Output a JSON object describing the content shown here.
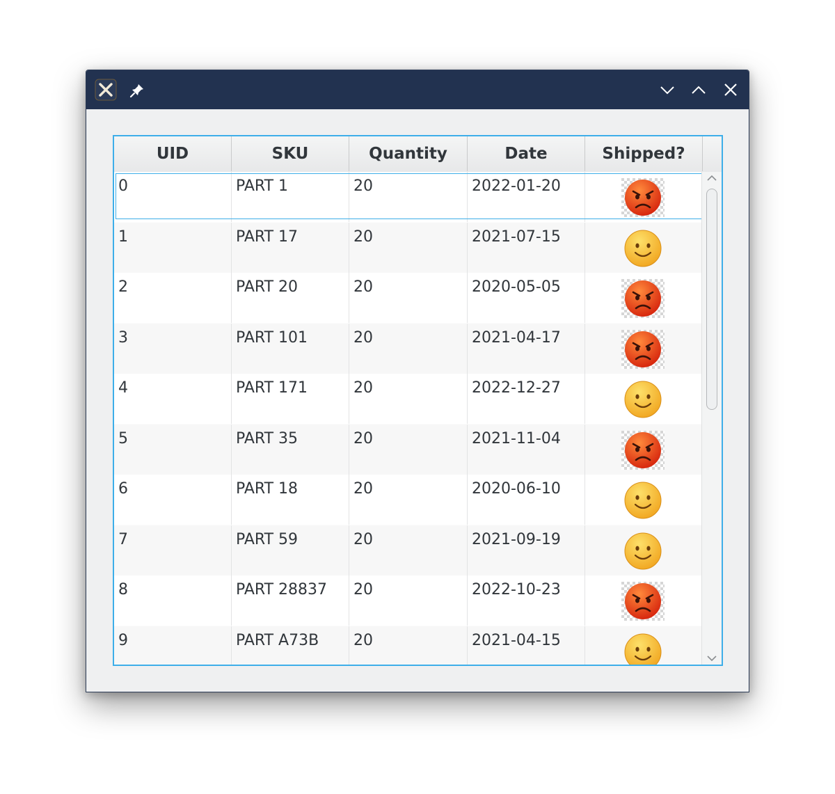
{
  "window": {
    "title": "",
    "controls": [
      "app-icon",
      "pin-icon",
      "minimize-icon",
      "maximize-icon",
      "close-icon"
    ]
  },
  "table": {
    "columns": [
      "UID",
      "SKU",
      "Quantity",
      "Date",
      "Shipped?"
    ],
    "selected_row": 0,
    "rows": [
      {
        "uid": "0",
        "sku": "PART 1",
        "quantity": "20",
        "date": "2022-01-20",
        "shipped": "angry-face-icon"
      },
      {
        "uid": "1",
        "sku": "PART 17",
        "quantity": "20",
        "date": "2021-07-15",
        "shipped": "smiley-face-icon"
      },
      {
        "uid": "2",
        "sku": "PART 20",
        "quantity": "20",
        "date": "2020-05-05",
        "shipped": "angry-face-icon"
      },
      {
        "uid": "3",
        "sku": "PART 101",
        "quantity": "20",
        "date": "2021-04-17",
        "shipped": "angry-face-icon"
      },
      {
        "uid": "4",
        "sku": "PART 171",
        "quantity": "20",
        "date": "2022-12-27",
        "shipped": "smiley-face-icon"
      },
      {
        "uid": "5",
        "sku": "PART 35",
        "quantity": "20",
        "date": "2021-11-04",
        "shipped": "angry-face-icon"
      },
      {
        "uid": "6",
        "sku": "PART 18",
        "quantity": "20",
        "date": "2020-06-10",
        "shipped": "smiley-face-icon"
      },
      {
        "uid": "7",
        "sku": "PART 59",
        "quantity": "20",
        "date": "2021-09-19",
        "shipped": "smiley-face-icon"
      },
      {
        "uid": "8",
        "sku": "PART 28837",
        "quantity": "20",
        "date": "2022-10-23",
        "shipped": "angry-face-icon"
      },
      {
        "uid": "9",
        "sku": "PART A73B",
        "quantity": "20",
        "date": "2021-04-15",
        "shipped": "smiley-face-icon"
      }
    ]
  },
  "colors": {
    "titlebar": "#223250",
    "accent": "#3daee9",
    "window_bg": "#eff0f1",
    "angry_red": "#e8341c",
    "smiley_yellow": "#fcc43a"
  }
}
